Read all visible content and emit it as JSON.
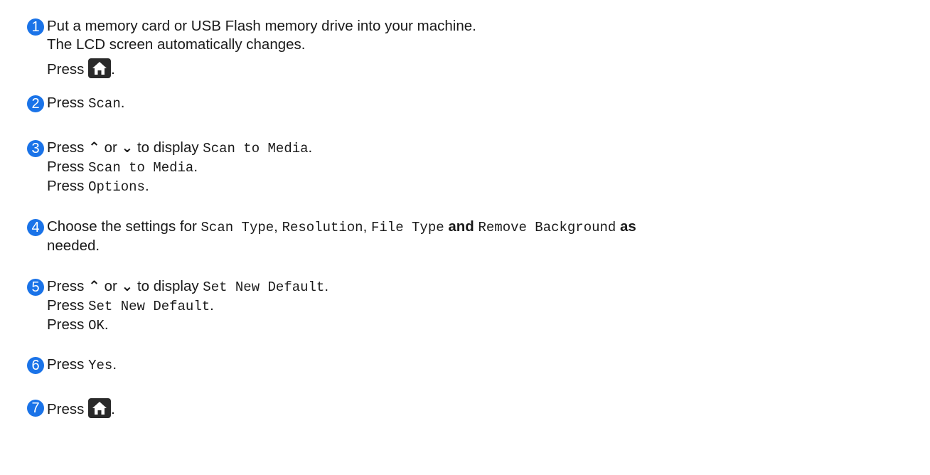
{
  "colors": {
    "step_badge": "#1a73e8",
    "home_button": "#2a2a2a"
  },
  "icons": {
    "home": "home-icon",
    "up": "up-arrow-icon",
    "down": "down-arrow-icon"
  },
  "arrows": {
    "up": "⌃",
    "down": "⌄"
  },
  "steps": [
    {
      "number": "1",
      "line1": "Put a memory card or USB Flash memory drive into your machine.",
      "line2": "The LCD screen automatically changes.",
      "line3_prefix": "Press",
      "line3_suffix": "."
    },
    {
      "number": "2",
      "press": "Press",
      "value": "Scan",
      "suffix": "."
    },
    {
      "number": "3",
      "l1_press": "Press",
      "l1_or": "or",
      "l1_to_display": "to display",
      "l1_value": "Scan to Media",
      "l1_suffix": ".",
      "l2_press": "Press",
      "l2_value": "Scan to Media",
      "l2_suffix": ".",
      "l3_press": "Press",
      "l3_value": "Options",
      "l3_suffix": "."
    },
    {
      "number": "4",
      "prefix": "Choose the settings for",
      "v1": "Scan Type",
      "sep1": ",",
      "v2": "Resolution",
      "sep2": ",",
      "v3": "File Type",
      "and": "and",
      "v4": "Remove Background",
      "as": "as",
      "line2": "needed."
    },
    {
      "number": "5",
      "l1_press": "Press",
      "l1_or": "or",
      "l1_to_display": "to display",
      "l1_value": "Set New Default",
      "l1_suffix": ".",
      "l2_press": "Press",
      "l2_value": "Set New Default",
      "l2_suffix": ".",
      "l3_press": "Press",
      "l3_value": "OK",
      "l3_suffix": "."
    },
    {
      "number": "6",
      "press": "Press",
      "value": "Yes",
      "suffix": "."
    },
    {
      "number": "7",
      "press": "Press",
      "suffix": "."
    }
  ]
}
